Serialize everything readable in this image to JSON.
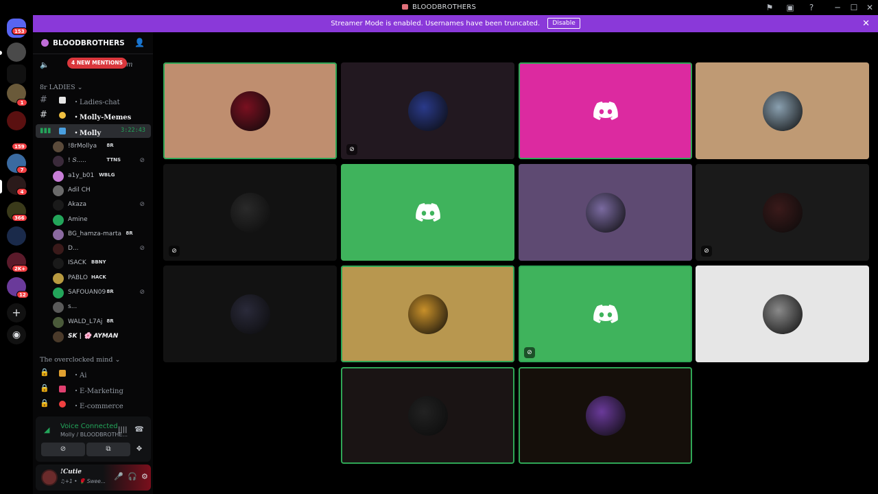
{
  "window": {
    "title": "BLOODBROTHERS",
    "controls": [
      "inbox-icon",
      "screen-icon",
      "help-icon",
      "minimize",
      "maximize",
      "close"
    ]
  },
  "banner": {
    "message": "Streamer Mode is enabled. Usernames have been truncated.",
    "disable_label": "Disable",
    "color": "#8a39d9"
  },
  "server_rail": {
    "home_badge": "153",
    "badges": [
      "1",
      "159",
      "7",
      "4",
      "366",
      "2K+",
      "12"
    ]
  },
  "server": {
    "name": "BLOODBROTHERS",
    "mentions_label": "4 NEW MENTIONS",
    "top_channel_tail": "om"
  },
  "categories": {
    "ladies": "8r LADIES",
    "overclocked": "The overclocked mind"
  },
  "channels": {
    "ladies_chat": "・Ladies-chat",
    "molly_memes": "・Molly-Memes",
    "molly_voice": "・Molly",
    "ai": "・Ai",
    "emarketing": "・E-Marketing",
    "ecommerce": "・E-commerce"
  },
  "voice_timer": "3:22:43",
  "voice_users": [
    {
      "name": "!8rMollya",
      "tag": "8R",
      "color": "#5a4a3a",
      "muted": false
    },
    {
      "name": "! 𝑆.....",
      "tag": "TTNS",
      "color": "#3a2a3a",
      "muted": true
    },
    {
      "name": "a1y_b01",
      "tag": "WBLG",
      "color": "#c77dd6",
      "muted": false
    },
    {
      "name": "Adil CH",
      "tag": "",
      "color": "#6a6a6a",
      "muted": false
    },
    {
      "name": "Akaza",
      "tag": "",
      "color": "#1a1a1a",
      "muted": true
    },
    {
      "name": "Amine",
      "tag": "",
      "color": "#23a55a",
      "muted": false
    },
    {
      "name": "BG_hamza-marta",
      "tag": "8R",
      "color": "#8a6aa0",
      "muted": false
    },
    {
      "name": "D...",
      "tag": "",
      "color": "#3a1a1a",
      "muted": true
    },
    {
      "name": "ISACK",
      "tag": "BBNY",
      "color": "#1a1a1a",
      "muted": false
    },
    {
      "name": "PABLO",
      "tag": "HACK",
      "color": "#b89a40",
      "muted": false
    },
    {
      "name": "SAFOUAN09",
      "tag": "8R",
      "color": "#23a55a",
      "muted": true
    },
    {
      "name": "s...",
      "tag": "",
      "color": "#5a5a5a",
      "muted": false
    },
    {
      "name": "WALD_L7Aj",
      "tag": "8R",
      "color": "#4a5a3a",
      "muted": false
    },
    {
      "name": "SK | 🌸 AYMAN",
      "tag": "",
      "color": "#4a3a2a",
      "muted": false
    }
  ],
  "voice_panel": {
    "status": "Voice Connected",
    "sub": "Molly / BLOODBROTHE..."
  },
  "user_panel": {
    "name": "!Cutie",
    "status": "♫+1 • 🌹 Swee..."
  },
  "tiles": [
    {
      "bg": "#bf8e6f",
      "speaking": true,
      "muted": false,
      "discord": false,
      "avatar": "#7a1020"
    },
    {
      "bg": "#221820",
      "speaking": false,
      "muted": true,
      "discord": false,
      "avatar": "#2a3a8a"
    },
    {
      "bg": "#dc2aa0",
      "speaking": true,
      "muted": false,
      "discord": true,
      "avatar": ""
    },
    {
      "bg": "#bf9a74",
      "speaking": false,
      "muted": false,
      "discord": false,
      "avatar": "#8aa0b0"
    },
    {
      "bg": "#121212",
      "speaking": false,
      "muted": true,
      "discord": false,
      "avatar": "#2a2a2a"
    },
    {
      "bg": "#3fb35c",
      "speaking": false,
      "muted": false,
      "discord": true,
      "avatar": ""
    },
    {
      "bg": "#5e4a72",
      "speaking": false,
      "muted": false,
      "discord": false,
      "avatar": "#7a6aa0"
    },
    {
      "bg": "#1a1a1a",
      "speaking": false,
      "muted": true,
      "discord": false,
      "avatar": "#3a1a1a"
    },
    {
      "bg": "#121212",
      "speaking": false,
      "muted": false,
      "discord": false,
      "avatar": "#2a2a3a"
    },
    {
      "bg": "#b8974f",
      "speaking": true,
      "muted": false,
      "discord": false,
      "avatar": "#c8902a"
    },
    {
      "bg": "#3fb35c",
      "speaking": true,
      "muted": true,
      "discord": true,
      "avatar": ""
    },
    {
      "bg": "#e6e6e6",
      "speaking": false,
      "muted": false,
      "discord": false,
      "avatar": "#8a8a8a"
    },
    {
      "bg": "#1a1414",
      "speaking": true,
      "muted": false,
      "discord": false,
      "avatar": "#222"
    },
    {
      "bg": "#150f0a",
      "speaking": true,
      "muted": false,
      "discord": false,
      "avatar": "#6a3a9a"
    }
  ]
}
